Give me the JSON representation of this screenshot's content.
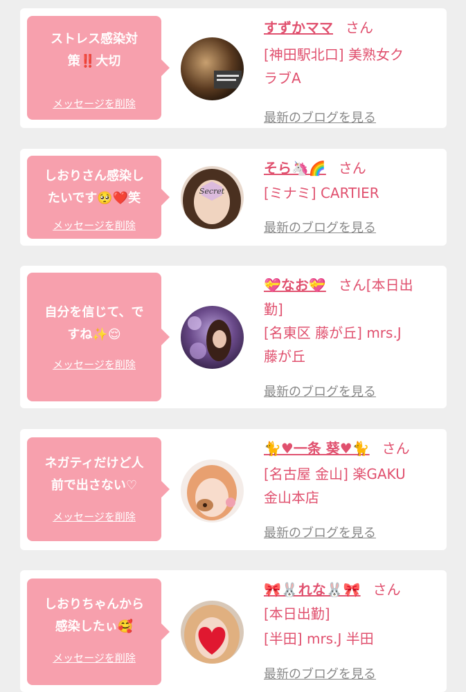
{
  "cards": [
    {
      "message_lines": [
        "ストレス感染対",
        "策‼️大切"
      ],
      "delete_label": "メッセージを削除",
      "name": "すずかママ",
      "honorific": "さん",
      "shop_lines": [
        "[神田駅北口] 美熟女ク",
        "ラブA"
      ],
      "blog_label": "最新のブログを見る"
    },
    {
      "message_lines": [
        "しおりさん感染し",
        "たいです🥺❤️笑"
      ],
      "delete_label": "メッセージを削除",
      "name": "そら🦄🌈",
      "honorific": "さん",
      "shop_lines": [
        "[ミナミ] CARTIER"
      ],
      "avatar_text": "Secret",
      "blog_label": "最新のブログを見る"
    },
    {
      "message_lines": [
        "自分を信じて、で",
        "すね✨😌"
      ],
      "delete_label": "メッセージを削除",
      "name": "💝なお💝",
      "honorific": "さん[本日出",
      "honorific_cont": "勤]",
      "shop_lines": [
        "[名東区 藤が丘] mrs.J",
        "藤が丘"
      ],
      "blog_label": "最新のブログを見る"
    },
    {
      "message_lines": [
        "ネガティだけど人",
        "前で出さない♡"
      ],
      "delete_label": "メッセージを削除",
      "name": "🐈♥一条 葵♥🐈",
      "honorific": "さん",
      "shop_lines": [
        "[名古屋 金山] 楽GAKU",
        "金山本店"
      ],
      "blog_label": "最新のブログを見る"
    },
    {
      "message_lines": [
        "しおりちゃんから",
        "感染したぃ🥰"
      ],
      "delete_label": "メッセージを削除",
      "name": "🎀🐰れな🐰🎀",
      "honorific": "さん",
      "status": "[本日出勤]",
      "shop_lines": [
        "[半田] mrs.J 半田"
      ],
      "blog_label": "最新のブログを見る"
    }
  ],
  "colors": {
    "accent": "#e0506e",
    "bubble": "#f7a0ad",
    "background": "#eeeeee",
    "link_gray": "#888888"
  }
}
